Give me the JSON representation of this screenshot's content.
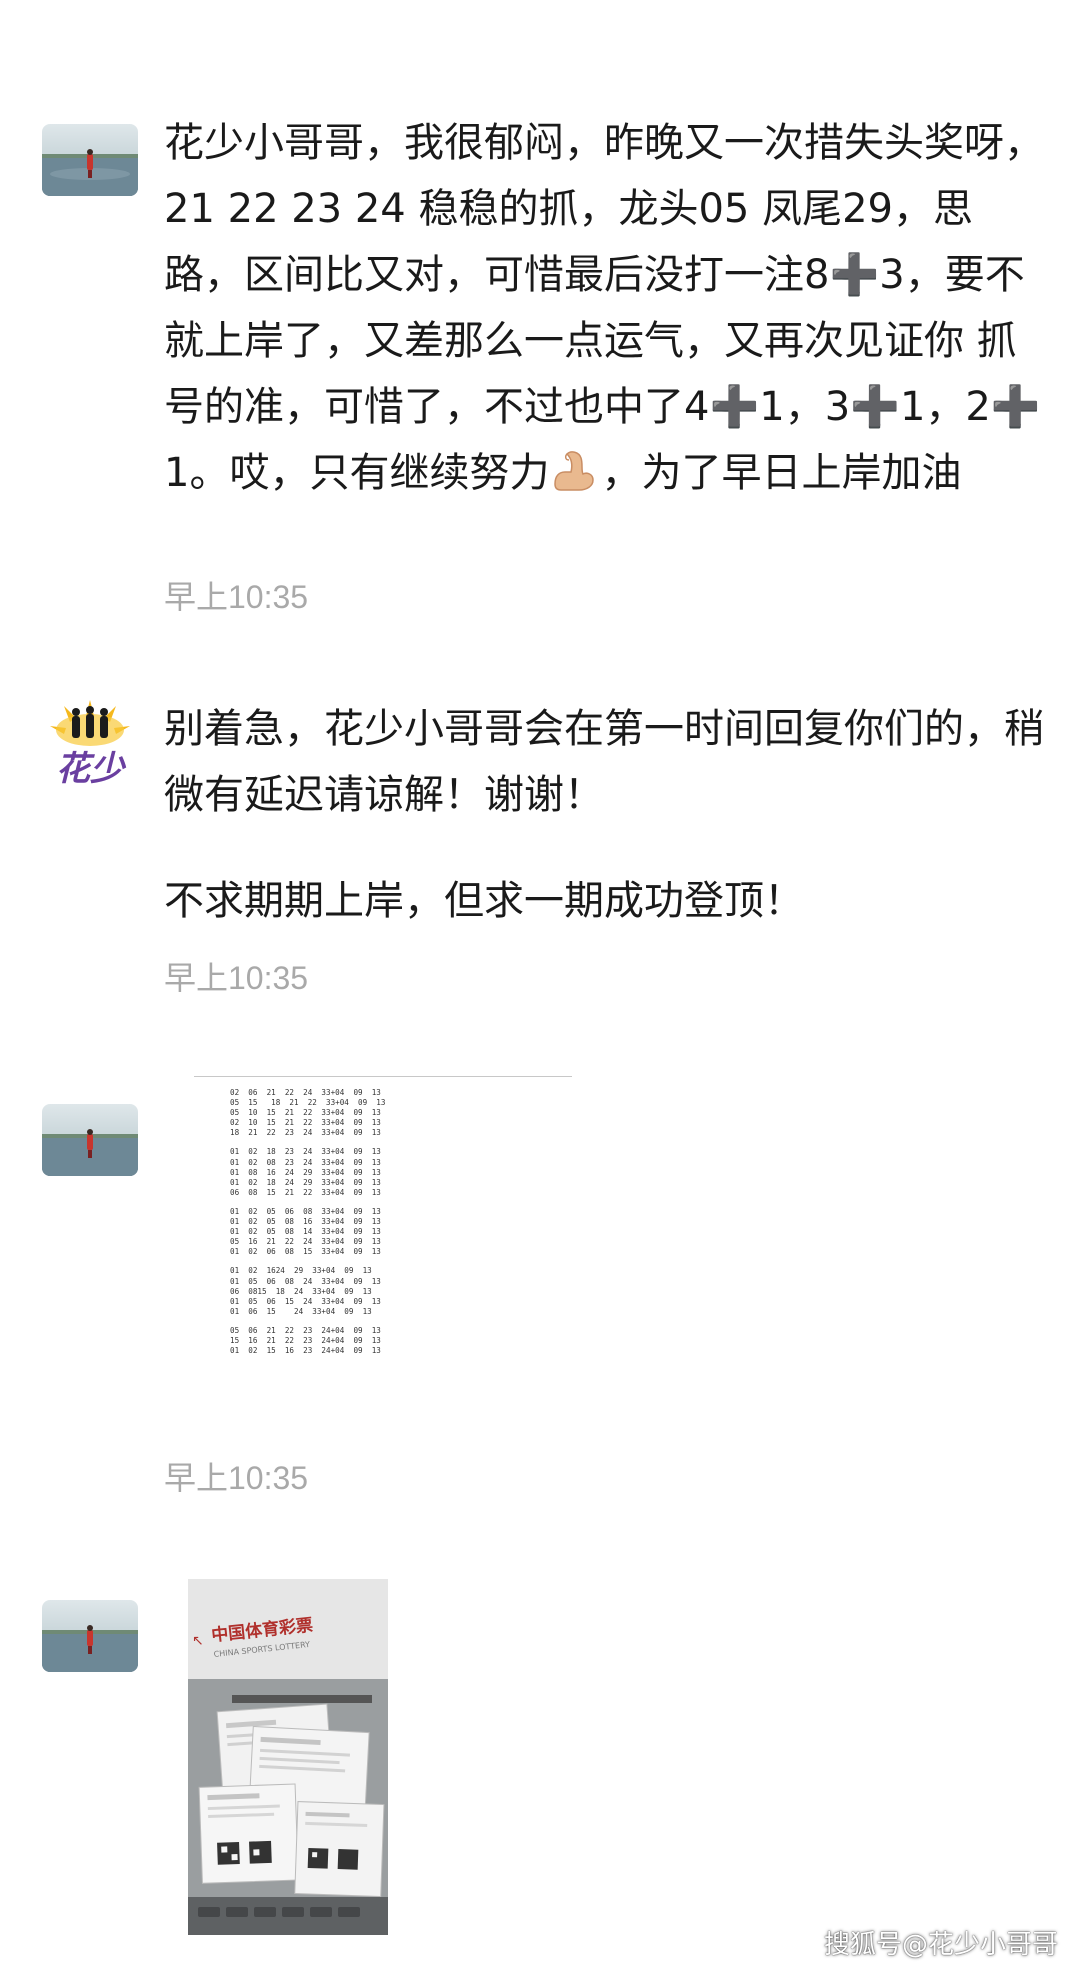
{
  "messages": [
    {
      "text_parts": [
        " 花少小哥哥，我很郁闷，昨晚又一次措失头奖呀，21 22 23 24 稳稳的抓，龙头05 凤尾29，思路，区间比又对，可惜最后没打一注8➕3，要不就上岸了，又差那么一点运气，又再次见证你 抓号的准，可惜了，不过也中了4➕1，3➕1，2➕1。哎，只有继续努力",
        "，为了早日上岸加油"
      ],
      "emoji": "flexed-biceps-icon",
      "time": "早上10:35"
    },
    {
      "para1": "别着急，花少小哥哥会在第一时间回复你们的，稍微有延迟请谅解！谢谢！",
      "para2": "不求期期上岸，但求一期成功登顶！",
      "avatar_text": "花少",
      "time": "早上10:35"
    },
    {
      "sheet_lines": [
        "02  06  21  22  24  33+04  09  13",
        "05  15   18  21  22  33+04  09  13",
        "05  10  15  21  22  33+04  09  13",
        "02  10  15  21  22  33+04  09  13",
        "18  21  22  23  24  33+04  09  13",
        "",
        "01  02  18  23  24  33+04  09  13",
        "01  02  08  23  24  33+04  09  13",
        "01  08  16  24  29  33+04  09  13",
        "01  02  18  24  29  33+04  09  13",
        "06  08  15  21  22  33+04  09  13",
        "",
        "01  02  05  06  08  33+04  09  13",
        "01  02  05  08  16  33+04  09  13",
        "01  02  05  08  14  33+04  09  13",
        "05  16  21  22  24  33+04  09  13",
        "01  02  06  08  15  33+04  09  13",
        "",
        "01  02  1624  29  33+04  09  13",
        "01  05  06  08  24  33+04  09  13",
        "06  0815  18  24  33+04  09  13",
        "01  05  06  15  24  33+04  09  13",
        "01  06  15    24  33+04  09  13",
        "",
        "05  06  21  22  23  24+04  09  13",
        "15  16  21  22  23  24+04  09  13",
        "01  02  15  16  23  24+04  09  13"
      ],
      "time": "早上10:35"
    },
    {
      "photo_title": "中国体育彩票",
      "photo_subtitle": "CHINA SPORTS LOTTERY"
    }
  ],
  "watermark": "搜狐号@花少小哥哥"
}
